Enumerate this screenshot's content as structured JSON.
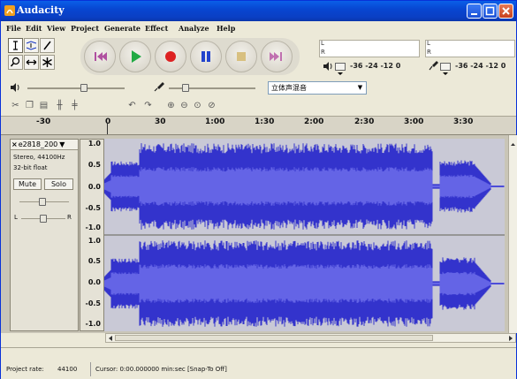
{
  "window": {
    "title": "Audacity"
  },
  "menu": [
    "File",
    "Edit",
    "View",
    "Project",
    "Generate",
    "Effect",
    "Analyze",
    "Help"
  ],
  "menu_hotkeys": [
    "F",
    "E",
    "V",
    "P",
    "G",
    "E",
    "A",
    "H"
  ],
  "tools": [
    "selection-tool",
    "envelope-tool",
    "draw-tool",
    "zoom-tool",
    "time-shift-tool",
    "multi-tool"
  ],
  "transport": [
    "skip-to-start",
    "play",
    "record",
    "pause",
    "stop",
    "skip-to-end"
  ],
  "meters": {
    "left_label": "L",
    "right_label": "R",
    "playback_scale": "-36  -24  -12  0",
    "record_scale": "-36  -24  -12  0"
  },
  "mixer": {
    "input_device": "立体声混音"
  },
  "ruler": {
    "labels": [
      "-30",
      "0",
      "30",
      "1:00",
      "1:30",
      "2:00",
      "2:30",
      "3:00",
      "3:30"
    ]
  },
  "track": {
    "name": "e2818_200",
    "format_line1": "Stereo, 44100Hz",
    "format_line2": "32-bit float",
    "mute_label": "Mute",
    "solo_label": "Solo",
    "pan_left": "L",
    "pan_right": "R",
    "scale_top": [
      "1.0",
      "0.5",
      "0.0",
      "-0.5",
      "-1.0"
    ],
    "scale_bottom": [
      "1.0",
      "0.5",
      "0.0",
      "-0.5",
      "-1.0"
    ]
  },
  "status": {
    "project_rate_label": "Project rate:",
    "project_rate_value": "44100",
    "cursor_text": "Cursor: 0:00.000000 min:sec   [Snap-To Off]"
  },
  "colors": {
    "waveform": "#3333cc",
    "waveform_rms": "#6464e6",
    "background": "#ece9d8",
    "titlebar": "#0a46d1"
  }
}
